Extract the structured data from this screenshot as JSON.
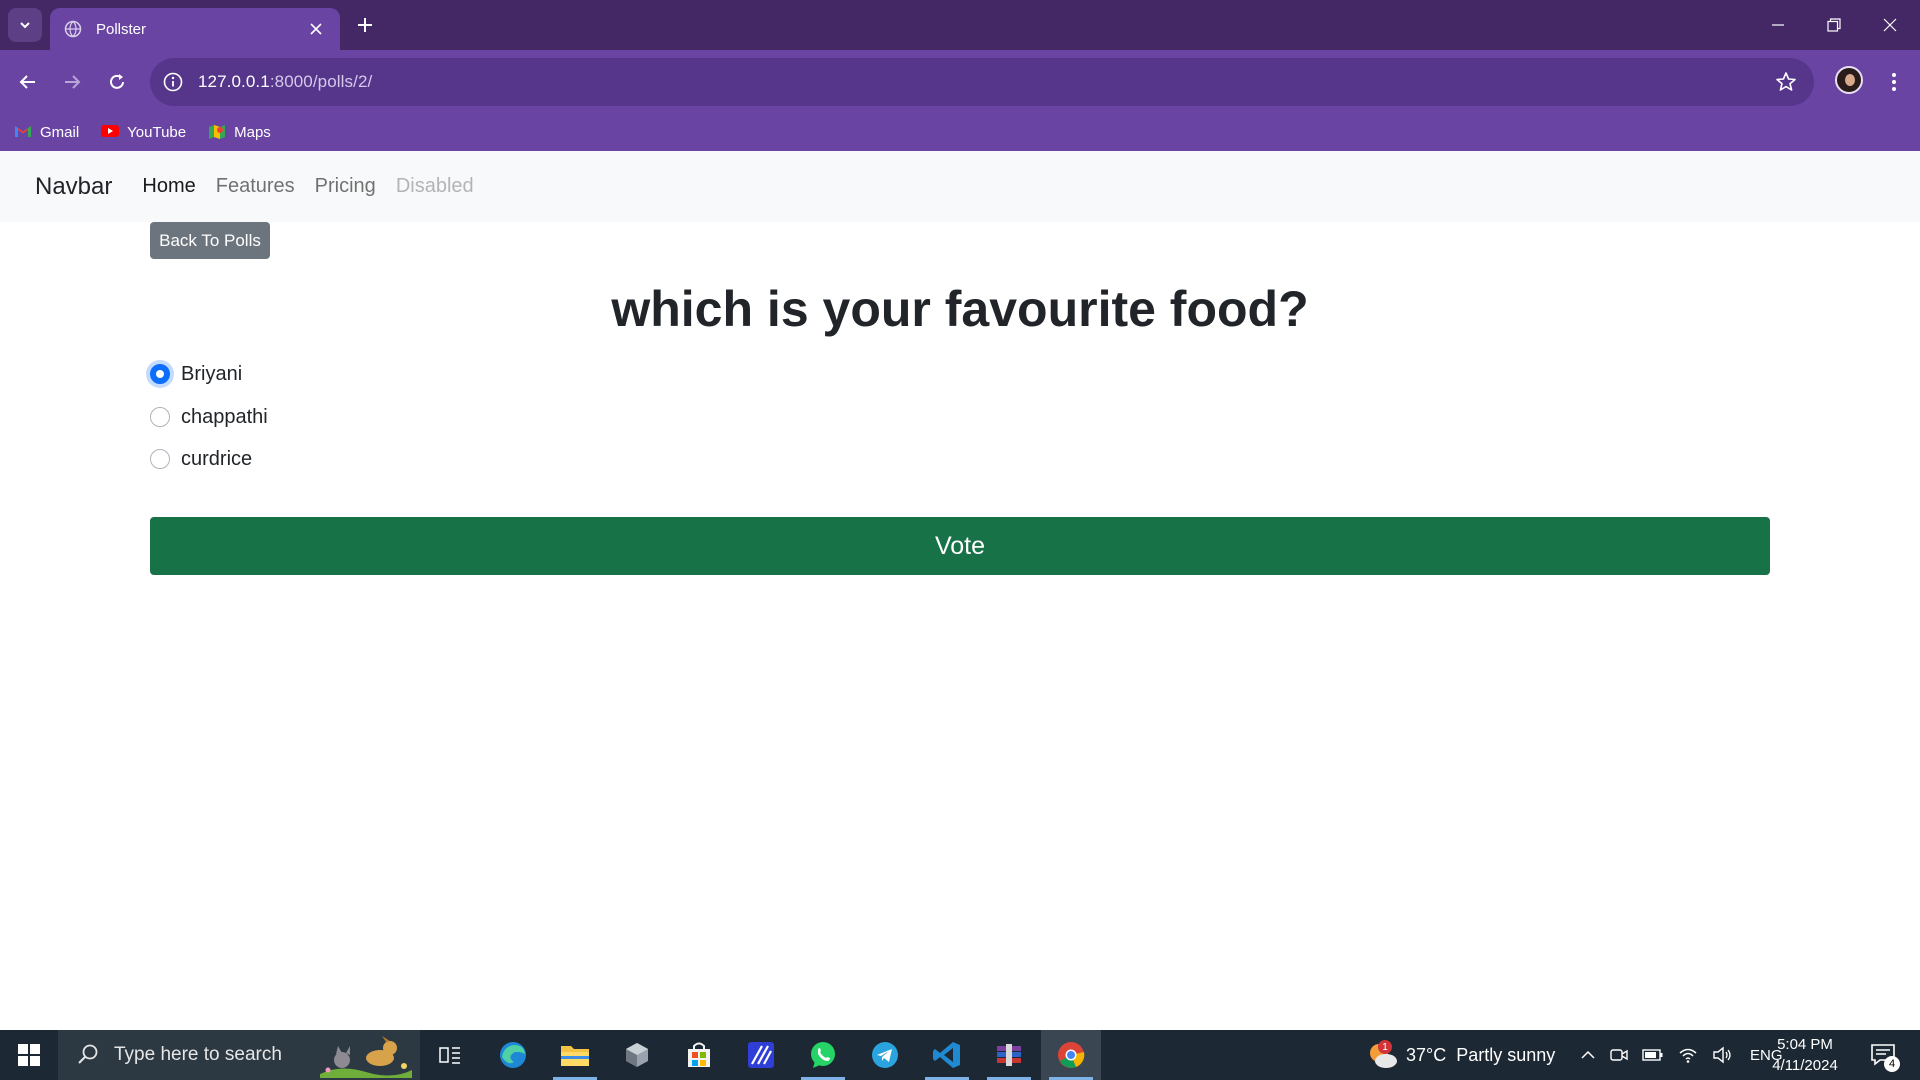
{
  "browser": {
    "tab_title": "Pollster",
    "url_host": "127.0.0.1",
    "url_path": ":8000/polls/2/",
    "bookmarks": [
      {
        "label": "Gmail",
        "icon": "gmail-icon"
      },
      {
        "label": "YouTube",
        "icon": "youtube-icon"
      },
      {
        "label": "Maps",
        "icon": "maps-icon"
      }
    ]
  },
  "navbar": {
    "brand": "Navbar",
    "links": [
      {
        "label": "Home",
        "state": "active"
      },
      {
        "label": "Features",
        "state": "normal"
      },
      {
        "label": "Pricing",
        "state": "normal"
      },
      {
        "label": "Disabled",
        "state": "disabled"
      }
    ]
  },
  "poll": {
    "back_label": "Back To Polls",
    "question": "which is your favourite food?",
    "choices": [
      {
        "label": "Briyani",
        "checked": true
      },
      {
        "label": "chappathi",
        "checked": false
      },
      {
        "label": "curdrice",
        "checked": false
      }
    ],
    "vote_label": "Vote"
  },
  "taskbar": {
    "search_placeholder": "Type here to search",
    "weather_badge": "1",
    "weather": "37°C  Partly sunny",
    "language": "ENG",
    "time": "5:04 PM",
    "date": "4/11/2024",
    "notification_count": "4"
  },
  "colors": {
    "titlebar": "#442866",
    "toolbar": "#6a44a3",
    "vote_button": "#187248",
    "back_button": "#6c757d",
    "radio_checked": "#0d6efd"
  }
}
